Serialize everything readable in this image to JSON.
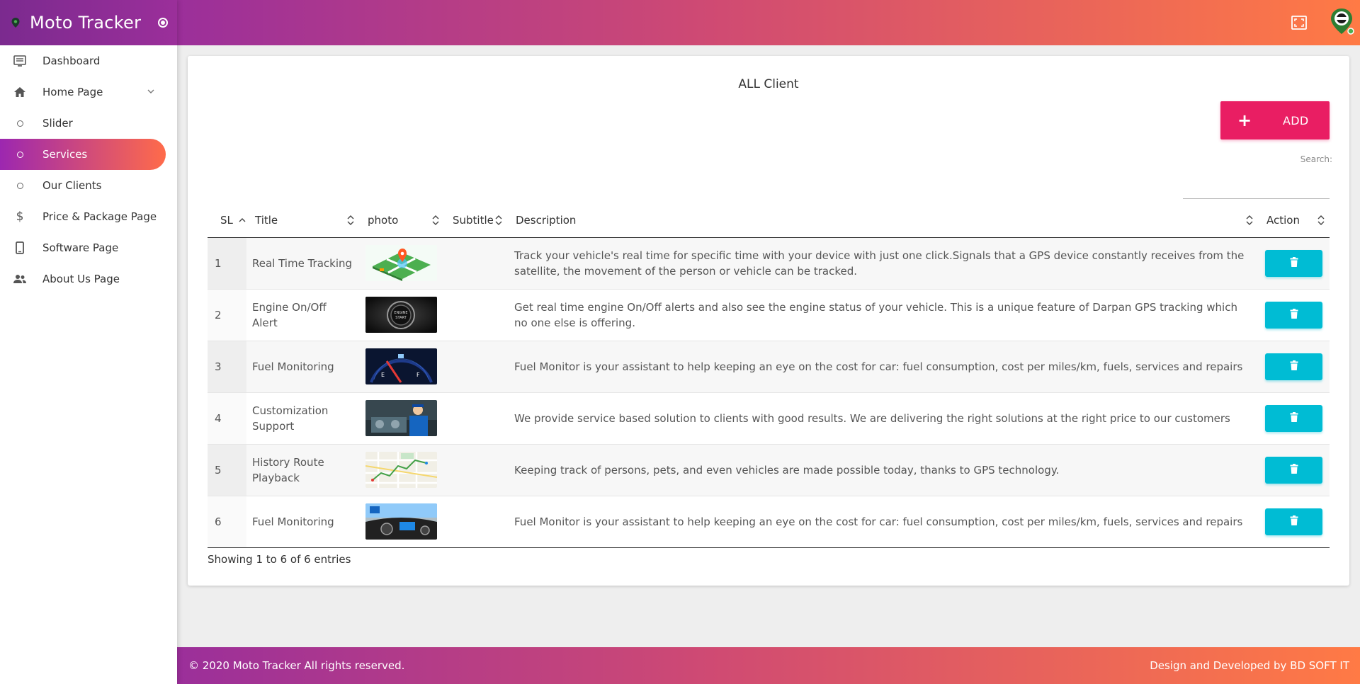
{
  "brand": {
    "name": "Moto Tracker"
  },
  "sidebar": {
    "items": [
      {
        "label": "Dashboard",
        "icon": "dashboard-icon"
      },
      {
        "label": "Home Page",
        "icon": "home-icon",
        "expandable": true
      },
      {
        "label": "Slider",
        "icon": "circle-icon"
      },
      {
        "label": "Services",
        "icon": "circle-icon",
        "active": true
      },
      {
        "label": "Our Clients",
        "icon": "circle-icon"
      },
      {
        "label": "Price & Package Page",
        "icon": "dollar-icon"
      },
      {
        "label": "Software Page",
        "icon": "phone-icon"
      },
      {
        "label": "About Us Page",
        "icon": "people-icon"
      }
    ]
  },
  "main": {
    "title": "ALL Client",
    "add_button": {
      "icon": "+",
      "label": "ADD"
    },
    "search": {
      "label": "Search:",
      "value": ""
    },
    "table": {
      "headers": [
        "SL",
        "Title",
        "photo",
        "Subtitle",
        "Description",
        "Action"
      ],
      "rows": [
        {
          "sl": "1",
          "title": "Real Time Tracking",
          "photo": "map-pin-image",
          "subtitle": "",
          "description": "Track your vehicle's real time for specific time with your device with just one click.Signals that a GPS device constantly receives from the satellite, the movement of the person or vehicle can be tracked."
        },
        {
          "sl": "2",
          "title": "Engine On/Off Alert",
          "photo": "engine-button-image",
          "subtitle": "",
          "description": "Get real time engine On/Off alerts and also see the engine status of your vehicle. This is a unique feature of Darpan GPS tracking which no one else is offering."
        },
        {
          "sl": "3",
          "title": "Fuel Monitoring",
          "photo": "fuel-gauge-image",
          "subtitle": "",
          "description": "Fuel Monitor is your assistant to help keeping an eye on the cost for car: fuel consumption, cost per miles/km, fuels, services and repairs"
        },
        {
          "sl": "4",
          "title": "Customization Support",
          "photo": "mechanic-image",
          "subtitle": "",
          "description": "We provide service based solution to clients with good results. We are delivering the right solutions at the right price to our customers"
        },
        {
          "sl": "5",
          "title": "History Route Playback",
          "photo": "route-map-image",
          "subtitle": "",
          "description": "Keeping track of persons, pets, and even vehicles are made possible today, thanks to GPS technology."
        },
        {
          "sl": "6",
          "title": "Fuel Monitoring",
          "photo": "car-dashboard-image",
          "subtitle": "",
          "description": "Fuel Monitor is your assistant to help keeping an eye on the cost for car: fuel consumption, cost per miles/km, fuels, services and repairs"
        }
      ]
    },
    "showing": "Showing 1 to 6 of 6 entries"
  },
  "footer": {
    "left": "© 2020 Moto Tracker All rights reserved.",
    "right": "Design and Developed by BD SOFT IT"
  },
  "colors": {
    "accent_pink": "#e91e63",
    "action_cyan": "#00bcd4",
    "gradient_start": "#9b2f9a",
    "gradient_end": "#ff7a45"
  }
}
